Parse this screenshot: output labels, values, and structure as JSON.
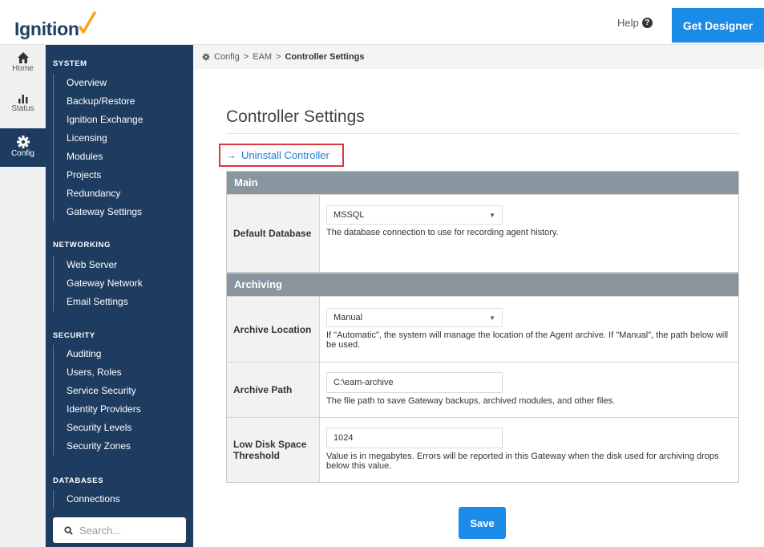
{
  "header": {
    "logo_text": "Ignition",
    "help_label": "Help",
    "get_designer_label": "Get Designer"
  },
  "rail": [
    {
      "label": "Home",
      "icon": "home-icon"
    },
    {
      "label": "Status",
      "icon": "status-icon"
    },
    {
      "label": "Config",
      "icon": "gear-icon",
      "active": true
    }
  ],
  "sidebar": {
    "sections": [
      {
        "title": "SYSTEM",
        "items": [
          "Overview",
          "Backup/Restore",
          "Ignition Exchange",
          "Licensing",
          "Modules",
          "Projects",
          "Redundancy",
          "Gateway Settings"
        ]
      },
      {
        "title": "NETWORKING",
        "items": [
          "Web Server",
          "Gateway Network",
          "Email Settings"
        ]
      },
      {
        "title": "SECURITY",
        "items": [
          "Auditing",
          "Users, Roles",
          "Service Security",
          "Identity Providers",
          "Security Levels",
          "Security Zones"
        ]
      },
      {
        "title": "DATABASES",
        "items": [
          "Connections"
        ]
      }
    ],
    "search_placeholder": "Search..."
  },
  "breadcrumb": {
    "items": [
      "Config",
      "EAM"
    ],
    "separator": ">",
    "current": "Controller Settings"
  },
  "page": {
    "title": "Controller Settings",
    "uninstall_label": "Uninstall Controller"
  },
  "panels": {
    "main": {
      "title": "Main",
      "default_database_label": "Default Database",
      "default_database_value": "MSSQL",
      "default_database_desc": "The database connection to use for recording agent history."
    },
    "archiving": {
      "title": "Archiving",
      "archive_location_label": "Archive Location",
      "archive_location_value": "Manual",
      "archive_location_desc": "If \"Automatic\", the system will manage the location of the Agent archive. If \"Manual\", the path below will be used.",
      "archive_path_label": "Archive Path",
      "archive_path_value": "C:\\eam-archive",
      "archive_path_desc": "The file path to save Gateway backups, archived modules, and other files.",
      "low_disk_label": "Low Disk Space Threshold",
      "low_disk_value": "1024",
      "low_disk_desc": "Value is in megabytes. Errors will be reported in this Gateway when the disk used for archiving drops below this value."
    }
  },
  "save_label": "Save",
  "colors": {
    "brand_blue": "#1a8ce8",
    "sidebar_navy": "#1e3c60",
    "panel_header": "#8a969f",
    "highlight_red": "#d9363e",
    "link_blue": "#1f7bd4",
    "logo_orange": "#f7a41d"
  }
}
